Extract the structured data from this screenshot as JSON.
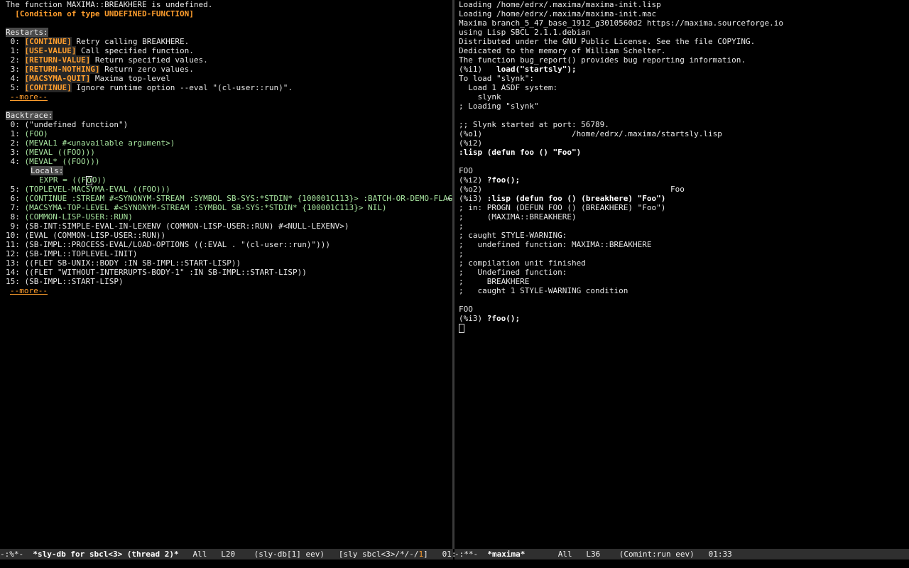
{
  "left": {
    "header": {
      "error_message": "The function MAXIMA::BREAKHERE is undefined.",
      "condition": "  [Condition of type UNDEFINED-FUNCTION]"
    },
    "restarts_label": "Restarts:",
    "restarts": [
      {
        "num": " 0: ",
        "tag": "[CONTINUE]",
        "desc": " Retry calling BREAKHERE."
      },
      {
        "num": " 1: ",
        "tag": "[USE-VALUE]",
        "desc": " Call specified function."
      },
      {
        "num": " 2: ",
        "tag": "[RETURN-VALUE]",
        "desc": " Return specified values."
      },
      {
        "num": " 3: ",
        "tag": "[RETURN-NOTHING]",
        "desc": " Return zero values."
      },
      {
        "num": " 4: ",
        "tag": "[MACSYMA-QUIT]",
        "desc": " Maxima top-level"
      },
      {
        "num": " 5: ",
        "tag": "[CONTINUE]",
        "desc": " Ignore runtime option --eval \"(cl-user::run)\"."
      }
    ],
    "more_label": "--more--",
    "backtrace_label": "Backtrace:",
    "frames": [
      {
        "num": " 0: ",
        "text": "(\"undefined function\")",
        "style": "w"
      },
      {
        "num": " 1: ",
        "text": "(FOO)",
        "style": "green"
      },
      {
        "num": " 2: ",
        "text": "(MEVAL1 #<unavailable argument>)",
        "style": "green"
      },
      {
        "num": " 3: ",
        "text": "(MEVAL ((FOO)))",
        "style": "green"
      },
      {
        "num": " 4: ",
        "text": "(MEVAL* ((FOO)))",
        "style": "green"
      }
    ],
    "locals_label": "Locals:",
    "local_expr_pre": "EXPR = ((F",
    "local_expr_cursor": "O",
    "local_expr_post": "O))",
    "frames2": [
      {
        "num": " 5: ",
        "text": "(TOPLEVEL-MACSYMA-EVAL ((FOO)))",
        "style": "green"
      },
      {
        "num": " 6: ",
        "text": "(CONTINUE :STREAM #<SYNONYM-STREAM :SYMBOL SB-SYS:*STDIN* {100001C113}> :BATCH-OR-DEMO-FLAG NIL :ONE",
        "style": "green"
      },
      {
        "num": " 7: ",
        "text": "(MACSYMA-TOP-LEVEL #<SYNONYM-STREAM :SYMBOL SB-SYS:*STDIN* {100001C113}> NIL)",
        "style": "green"
      },
      {
        "num": " 8: ",
        "text": "(COMMON-LISP-USER::RUN)",
        "style": "green"
      },
      {
        "num": " 9: ",
        "text": "(SB-INT:SIMPLE-EVAL-IN-LEXENV (COMMON-LISP-USER::RUN) #<NULL-LEXENV>)",
        "style": "w"
      },
      {
        "num": "10: ",
        "text": "(EVAL (COMMON-LISP-USER::RUN))",
        "style": "w"
      },
      {
        "num": "11: ",
        "text": "(SB-IMPL::PROCESS-EVAL/LOAD-OPTIONS ((:EVAL . \"(cl-user::run)\")))",
        "style": "w"
      },
      {
        "num": "12: ",
        "text": "(SB-IMPL::TOPLEVEL-INIT)",
        "style": "w"
      },
      {
        "num": "13: ",
        "text": "((FLET SB-UNIX::BODY :IN SB-IMPL::START-LISP))",
        "style": "w"
      },
      {
        "num": "14: ",
        "text": "((FLET \"WITHOUT-INTERRUPTS-BODY-1\" :IN SB-IMPL::START-LISP))",
        "style": "w"
      },
      {
        "num": "15: ",
        "text": "(SB-IMPL::START-LISP)",
        "style": "w"
      }
    ],
    "more_label2": "--more--",
    "truncation_arrow": "→"
  },
  "right": {
    "lines": [
      {
        "a": "Loading /home/edrx/.maxima/maxima-init.lisp",
        "b": ""
      },
      {
        "a": "Loading /home/edrx/.maxima/maxima-init.mac",
        "b": ""
      },
      {
        "a": "Maxima branch_5_47_base_1912_g3010560d2 https://maxima.sourceforge.io",
        "b": ""
      },
      {
        "a": "using Lisp SBCL 2.1.1.debian",
        "b": ""
      },
      {
        "a": "Distributed under the GNU Public License. See the file COPYING.",
        "b": ""
      },
      {
        "a": "Dedicated to the memory of William Schelter.",
        "b": ""
      },
      {
        "a": "The function bug_report() provides bug reporting information.",
        "b": ""
      },
      {
        "a": "(%i1)   ",
        "b": "load(\"startsly\");"
      },
      {
        "a": "To load \"slynk\":",
        "b": ""
      },
      {
        "a": "  Load 1 ASDF system:",
        "b": ""
      },
      {
        "a": "    slynk",
        "b": ""
      },
      {
        "a": "; Loading \"slynk\"",
        "b": ""
      },
      {
        "a": "",
        "b": ""
      },
      {
        "a": ";; Slynk started at port: 56789.",
        "b": ""
      },
      {
        "a": "(%o1)                   /home/edrx/.maxima/startsly.lisp",
        "b": ""
      },
      {
        "a": "(%i2)",
        "b": ""
      },
      {
        "a": "",
        "b": ":lisp (defun foo () \"Foo\")"
      },
      {
        "a": "",
        "b": ""
      },
      {
        "a": "FOO",
        "b": ""
      },
      {
        "a": "(%i2) ",
        "b": "?foo();"
      },
      {
        "a": "(%o2)                                        Foo",
        "b": ""
      },
      {
        "a": "(%i3) ",
        "b": ":lisp (defun foo () (breakhere) \"Foo\")"
      },
      {
        "a": "; in: PROGN (DEFUN FOO () (BREAKHERE) \"Foo\")",
        "b": ""
      },
      {
        "a": ";     (MAXIMA::BREAKHERE)",
        "b": ""
      },
      {
        "a": ";",
        "b": ""
      },
      {
        "a": "; caught STYLE-WARNING:",
        "b": ""
      },
      {
        "a": ";   undefined function: MAXIMA::BREAKHERE",
        "b": ""
      },
      {
        "a": ";",
        "b": ""
      },
      {
        "a": "; compilation unit finished",
        "b": ""
      },
      {
        "a": ";   Undefined function:",
        "b": ""
      },
      {
        "a": ";     BREAKHERE",
        "b": ""
      },
      {
        "a": ";   caught 1 STYLE-WARNING condition",
        "b": ""
      },
      {
        "a": "",
        "b": ""
      },
      {
        "a": "FOO",
        "b": ""
      },
      {
        "a": "(%i3) ",
        "b": "?foo();"
      }
    ]
  },
  "modeline_left": {
    "status": "-:%*-  ",
    "buffer": "*sly-db for sbcl<3> (thread 2)*",
    "position": "   All   L20    ",
    "mode": "(sly-db[1] eev)   ",
    "sly_pre": "[sly sbcl<3>/*/-/",
    "sly_num": "1",
    "sly_post": "]",
    "time": "   01:33"
  },
  "modeline_right": {
    "status": "-:**-  ",
    "buffer": "*maxima*",
    "position": "       All   L36    ",
    "mode": "(Comint:run eev)",
    "time": "   01:33"
  }
}
